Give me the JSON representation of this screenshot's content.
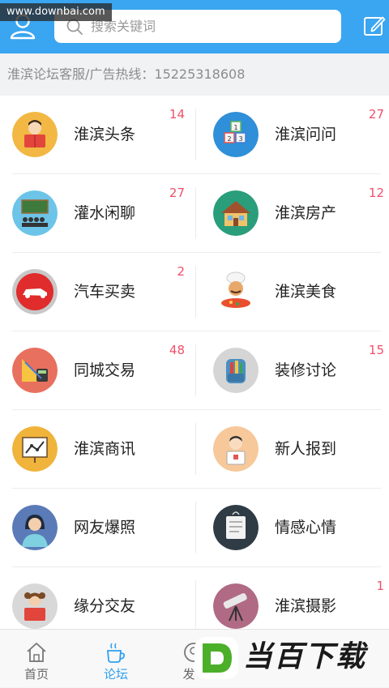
{
  "watermark": "www.downbai.com",
  "header": {
    "search_placeholder": "搜索关键词"
  },
  "hotline": "淮滨论坛客服/广告热线：15225318608",
  "forums": [
    {
      "name": "淮滨头条",
      "count": "14"
    },
    {
      "name": "淮滨问问",
      "count": "27"
    },
    {
      "name": "灌水闲聊",
      "count": "27"
    },
    {
      "name": "淮滨房产",
      "count": "12"
    },
    {
      "name": "汽车买卖",
      "count": "2"
    },
    {
      "name": "淮滨美食",
      "count": ""
    },
    {
      "name": "同城交易",
      "count": "48"
    },
    {
      "name": "装修讨论",
      "count": "15"
    },
    {
      "name": "淮滨商讯",
      "count": ""
    },
    {
      "name": "新人报到",
      "count": ""
    },
    {
      "name": "网友爆照",
      "count": ""
    },
    {
      "name": "情感心情",
      "count": ""
    },
    {
      "name": "缘分交友",
      "count": ""
    },
    {
      "name": "淮滨摄影",
      "count": "1"
    }
  ],
  "tabs": [
    {
      "label": "首页"
    },
    {
      "label": "论坛"
    },
    {
      "label": "发"
    }
  ],
  "logo_text": "当百下载",
  "colors": {
    "accent": "#3aa5f0",
    "badge": "#f0506a",
    "tab_active": "#2f9ff0"
  }
}
